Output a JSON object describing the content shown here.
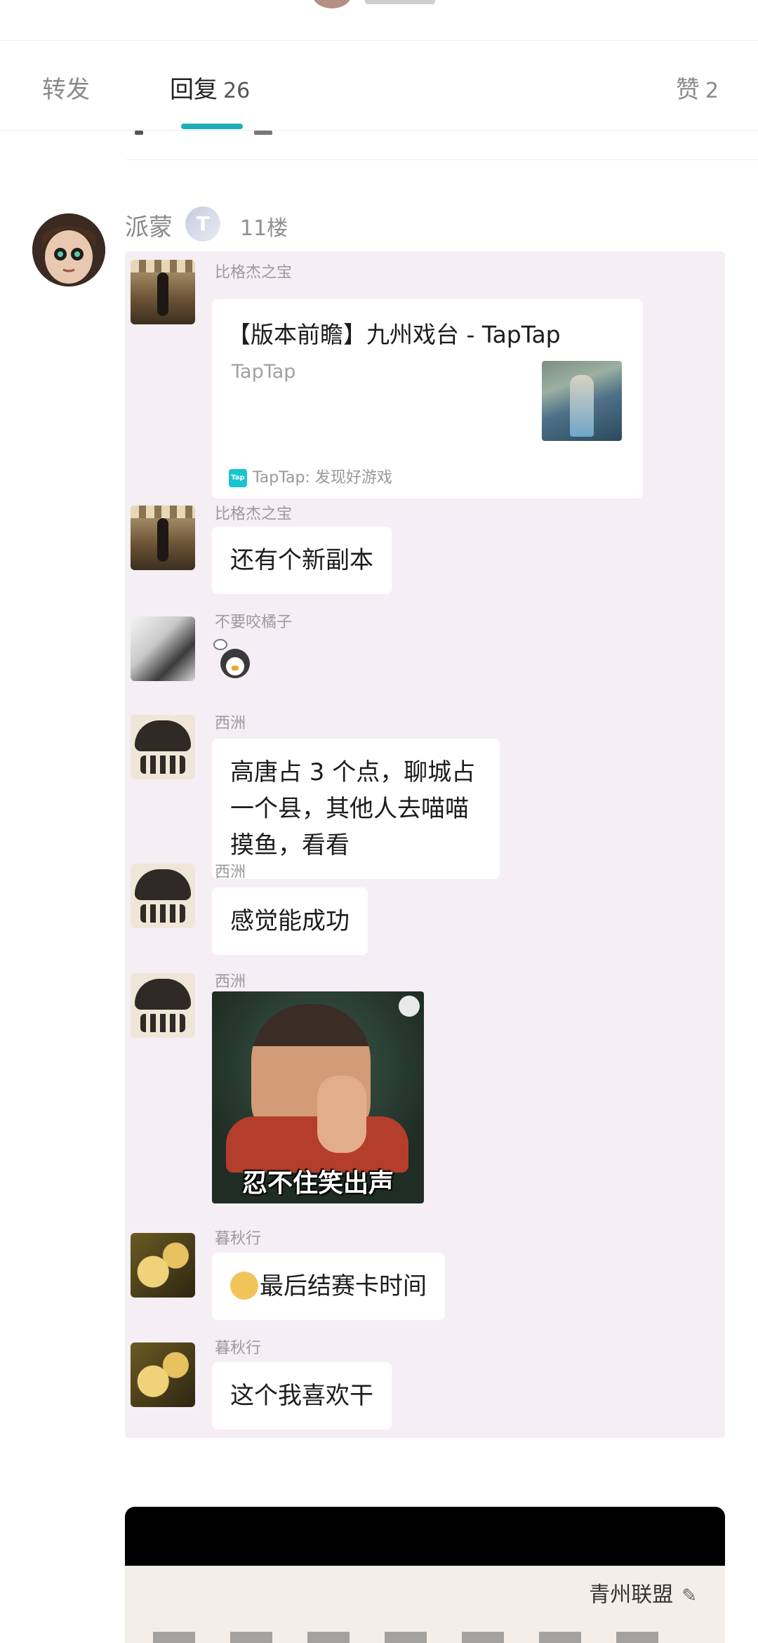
{
  "tabs": [
    {
      "label": "转发",
      "count": ""
    },
    {
      "label": "回复",
      "count": "26"
    },
    {
      "label": "赞",
      "count": "2"
    }
  ],
  "comment": {
    "author": "派蒙",
    "badge": "T",
    "floor": "11楼"
  },
  "chat": {
    "link_card": {
      "sender": "比格杰之宝",
      "title": "【版本前瞻】九州戏台 - TapTap",
      "subtitle": "TapTap",
      "footer_icon": "Tap",
      "footer": "TapTap: 发现好游戏"
    },
    "messages": [
      {
        "sender": "比格杰之宝",
        "text": "还有个新副本"
      },
      {
        "sender": "不要咬橘子",
        "sticker": "penguin-sticker"
      },
      {
        "sender": "西洲",
        "text": "高唐占 3 个点，聊城占一个县，其他人去喵喵摸鱼，看看"
      },
      {
        "sender": "西洲",
        "text": "感觉能成功"
      },
      {
        "sender": "西洲",
        "image_caption": "忍不住笑出声"
      },
      {
        "sender": "暮秋行",
        "text": "最后结赛卡时间"
      },
      {
        "sender": "暮秋行",
        "text": "这个我喜欢干"
      }
    ]
  },
  "embed": {
    "group_name": "青州联盟",
    "edit_icon": "✎"
  },
  "colors": {
    "accent": "#1eaeb9",
    "chat_bg": "#f5eef4"
  }
}
